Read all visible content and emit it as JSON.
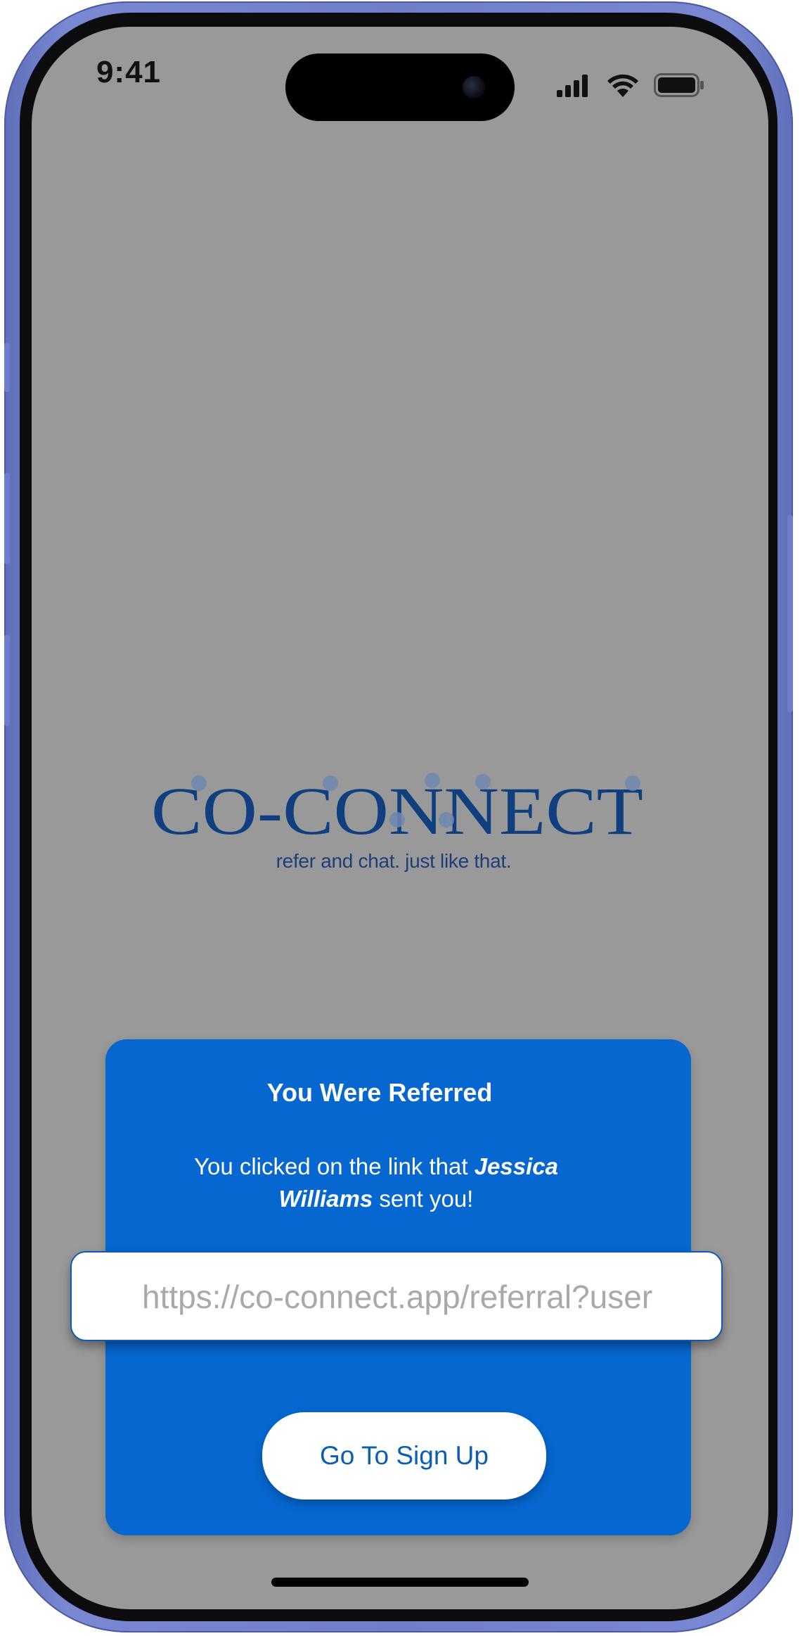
{
  "status_bar": {
    "time": "9:41"
  },
  "logo": {
    "wordmark": "CO-CONNECT",
    "tagline": "refer and chat. just like that.",
    "color": "#0f3f7f"
  },
  "referral_card": {
    "title": "You Were Referred",
    "message_prefix": "You clicked on the link that ",
    "referrer_name": "Jessica Williams",
    "message_suffix": " sent you!",
    "link_value": "https://co-connect.app/referral?user",
    "button_label": "Go To Sign Up",
    "accent_color": "#0567cf"
  },
  "icons": {
    "signal": "cellular-signal-icon",
    "wifi": "wifi-icon",
    "battery": "battery-icon"
  }
}
